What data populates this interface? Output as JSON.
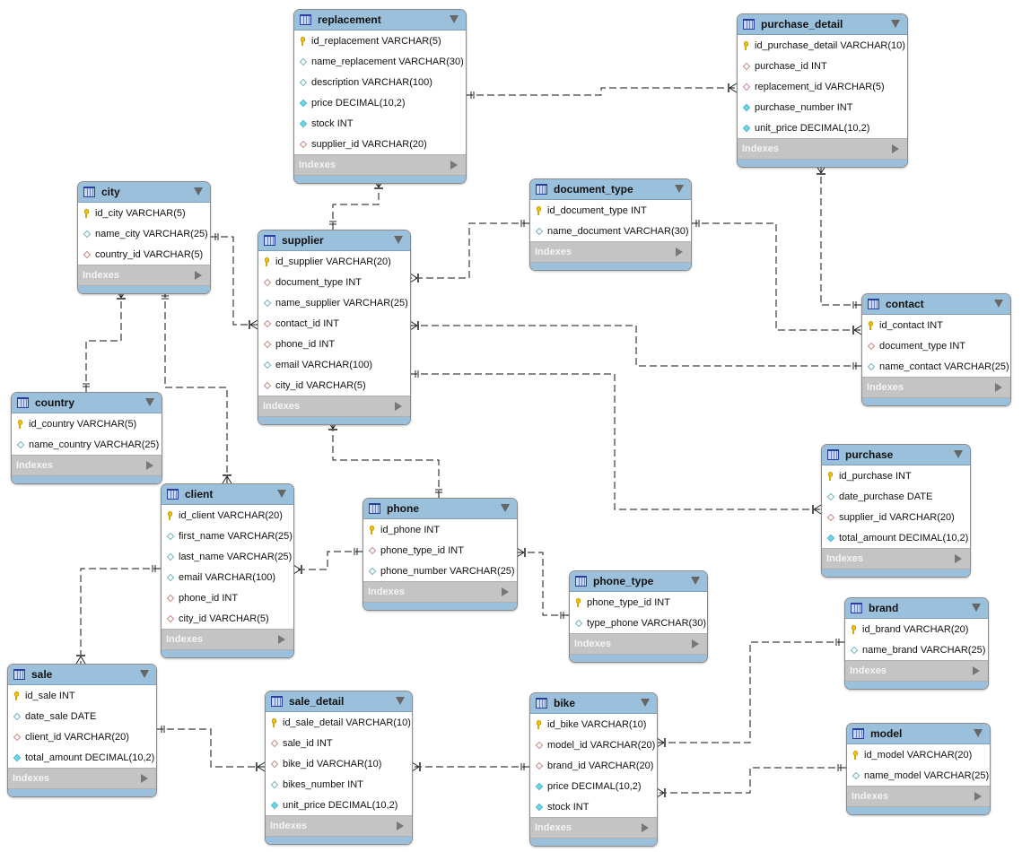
{
  "diagram": {
    "type": "EER diagram",
    "indexes_label": "Indexes",
    "tables": [
      {
        "name": "replacement",
        "columns": [
          {
            "text": "id_replacement VARCHAR(5)",
            "kind": "pk"
          },
          {
            "text": "name_replacement VARCHAR(30)",
            "kind": "nullable"
          },
          {
            "text": "description VARCHAR(100)",
            "kind": "nullable"
          },
          {
            "text": "price DECIMAL(10,2)",
            "kind": "not-null"
          },
          {
            "text": "stock INT",
            "kind": "not-null"
          },
          {
            "text": "supplier_id VARCHAR(20)",
            "kind": "fk"
          }
        ]
      },
      {
        "name": "purchase_detail",
        "columns": [
          {
            "text": "id_purchase_detail VARCHAR(10)",
            "kind": "pk"
          },
          {
            "text": "purchase_id INT",
            "kind": "fk"
          },
          {
            "text": "replacement_id VARCHAR(5)",
            "kind": "fk"
          },
          {
            "text": "purchase_number INT",
            "kind": "not-null"
          },
          {
            "text": "unit_price DECIMAL(10,2)",
            "kind": "not-null"
          }
        ]
      },
      {
        "name": "city",
        "columns": [
          {
            "text": "id_city VARCHAR(5)",
            "kind": "pk"
          },
          {
            "text": "name_city VARCHAR(25)",
            "kind": "nullable"
          },
          {
            "text": "country_id VARCHAR(5)",
            "kind": "fk"
          }
        ]
      },
      {
        "name": "document_type",
        "columns": [
          {
            "text": "id_document_type INT",
            "kind": "pk"
          },
          {
            "text": "name_document VARCHAR(30)",
            "kind": "nullable"
          }
        ]
      },
      {
        "name": "supplier",
        "columns": [
          {
            "text": "id_supplier VARCHAR(20)",
            "kind": "pk"
          },
          {
            "text": "document_type INT",
            "kind": "fk"
          },
          {
            "text": "name_supplier VARCHAR(25)",
            "kind": "nullable"
          },
          {
            "text": "contact_id INT",
            "kind": "fk"
          },
          {
            "text": "phone_id INT",
            "kind": "fk"
          },
          {
            "text": "email VARCHAR(100)",
            "kind": "nullable"
          },
          {
            "text": "city_id VARCHAR(5)",
            "kind": "fk"
          }
        ]
      },
      {
        "name": "contact",
        "columns": [
          {
            "text": "id_contact INT",
            "kind": "pk"
          },
          {
            "text": "document_type INT",
            "kind": "fk"
          },
          {
            "text": "name_contact VARCHAR(25)",
            "kind": "nullable"
          }
        ]
      },
      {
        "name": "country",
        "columns": [
          {
            "text": "id_country VARCHAR(5)",
            "kind": "pk"
          },
          {
            "text": "name_country VARCHAR(25)",
            "kind": "nullable"
          }
        ]
      },
      {
        "name": "purchase",
        "columns": [
          {
            "text": "id_purchase INT",
            "kind": "pk"
          },
          {
            "text": "date_purchase DATE",
            "kind": "nullable"
          },
          {
            "text": "supplier_id VARCHAR(20)",
            "kind": "fk"
          },
          {
            "text": "total_amount DECIMAL(10,2)",
            "kind": "not-null"
          }
        ]
      },
      {
        "name": "client",
        "columns": [
          {
            "text": "id_client VARCHAR(20)",
            "kind": "pk"
          },
          {
            "text": "first_name VARCHAR(25)",
            "kind": "nullable"
          },
          {
            "text": "last_name VARCHAR(25)",
            "kind": "nullable"
          },
          {
            "text": "email VARCHAR(100)",
            "kind": "nullable"
          },
          {
            "text": "phone_id INT",
            "kind": "fk"
          },
          {
            "text": "city_id VARCHAR(5)",
            "kind": "fk"
          }
        ]
      },
      {
        "name": "phone",
        "columns": [
          {
            "text": "id_phone INT",
            "kind": "pk"
          },
          {
            "text": "phone_type_id INT",
            "kind": "fk"
          },
          {
            "text": "phone_number VARCHAR(25)",
            "kind": "nullable"
          }
        ]
      },
      {
        "name": "phone_type",
        "columns": [
          {
            "text": "phone_type_id INT",
            "kind": "pk"
          },
          {
            "text": "type_phone VARCHAR(30)",
            "kind": "nullable"
          }
        ]
      },
      {
        "name": "brand",
        "columns": [
          {
            "text": "id_brand VARCHAR(20)",
            "kind": "pk"
          },
          {
            "text": "name_brand VARCHAR(25)",
            "kind": "nullable"
          }
        ]
      },
      {
        "name": "sale",
        "columns": [
          {
            "text": "id_sale INT",
            "kind": "pk"
          },
          {
            "text": "date_sale DATE",
            "kind": "nullable"
          },
          {
            "text": "client_id VARCHAR(20)",
            "kind": "fk"
          },
          {
            "text": "total_amount DECIMAL(10,2)",
            "kind": "not-null"
          }
        ]
      },
      {
        "name": "sale_detail",
        "columns": [
          {
            "text": "id_sale_detail VARCHAR(10)",
            "kind": "pk"
          },
          {
            "text": "sale_id INT",
            "kind": "fk"
          },
          {
            "text": "bike_id VARCHAR(10)",
            "kind": "fk"
          },
          {
            "text": "bikes_number INT",
            "kind": "nullable"
          },
          {
            "text": "unit_price DECIMAL(10,2)",
            "kind": "not-null"
          }
        ]
      },
      {
        "name": "bike",
        "columns": [
          {
            "text": "id_bike VARCHAR(10)",
            "kind": "pk"
          },
          {
            "text": "model_id VARCHAR(20)",
            "kind": "fk"
          },
          {
            "text": "brand_id VARCHAR(20)",
            "kind": "fk"
          },
          {
            "text": "price DECIMAL(10,2)",
            "kind": "not-null"
          },
          {
            "text": "stock INT",
            "kind": "not-null"
          }
        ]
      },
      {
        "name": "model",
        "columns": [
          {
            "text": "id_model VARCHAR(20)",
            "kind": "pk"
          },
          {
            "text": "name_model VARCHAR(25)",
            "kind": "nullable"
          }
        ]
      }
    ],
    "relationships": [
      {
        "from": "replacement",
        "to": "purchase_detail",
        "from_card": "one",
        "to_card": "many"
      },
      {
        "from": "supplier",
        "to": "replacement",
        "from_card": "one",
        "to_card": "many"
      },
      {
        "from": "purchase",
        "to": "purchase_detail",
        "from_card": "one",
        "to_card": "many"
      },
      {
        "from": "document_type",
        "to": "supplier",
        "from_card": "one",
        "to_card": "many"
      },
      {
        "from": "document_type",
        "to": "contact",
        "from_card": "one",
        "to_card": "many"
      },
      {
        "from": "city",
        "to": "supplier",
        "from_card": "one",
        "to_card": "many"
      },
      {
        "from": "contact",
        "to": "supplier",
        "from_card": "one",
        "to_card": "many"
      },
      {
        "from": "supplier",
        "to": "purchase",
        "from_card": "one",
        "to_card": "many"
      },
      {
        "from": "country",
        "to": "city",
        "from_card": "one",
        "to_card": "many"
      },
      {
        "from": "city",
        "to": "client",
        "from_card": "one",
        "to_card": "many"
      },
      {
        "from": "phone",
        "to": "supplier",
        "from_card": "one",
        "to_card": "many"
      },
      {
        "from": "phone",
        "to": "client",
        "from_card": "one",
        "to_card": "many"
      },
      {
        "from": "phone_type",
        "to": "phone",
        "from_card": "one",
        "to_card": "many"
      },
      {
        "from": "client",
        "to": "sale",
        "from_card": "one",
        "to_card": "many"
      },
      {
        "from": "sale",
        "to": "sale_detail",
        "from_card": "one",
        "to_card": "many"
      },
      {
        "from": "bike",
        "to": "sale_detail",
        "from_card": "one",
        "to_card": "many"
      },
      {
        "from": "brand",
        "to": "bike",
        "from_card": "one",
        "to_card": "many"
      },
      {
        "from": "model",
        "to": "bike",
        "from_card": "one",
        "to_card": "many"
      }
    ]
  },
  "colors": {
    "header": "#9ac0dc",
    "indexes_bar": "#c4c4c4",
    "pk_key": "#f1c40f",
    "fk_diamond": "#c8857f",
    "not_null_diamond": "#6fd6e6",
    "nullable_diamond": "#6fb3bf"
  }
}
